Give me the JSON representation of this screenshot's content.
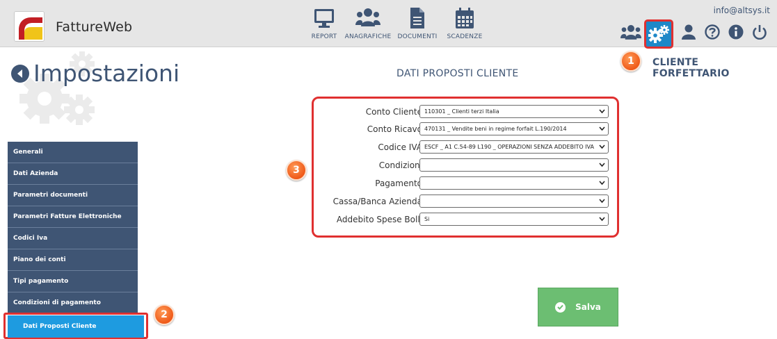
{
  "app": {
    "brand": "FattureWeb",
    "user_email": "info@altsys.it"
  },
  "nav": [
    {
      "label": "REPORT",
      "icon": "monitor-icon"
    },
    {
      "label": "ANAGRAFICHE",
      "icon": "users-icon"
    },
    {
      "label": "DOCUMENTI",
      "icon": "document-icon"
    },
    {
      "label": "SCADENZE",
      "icon": "calendar-icon"
    }
  ],
  "toolbar_icons": [
    "users-icon",
    "gears-icon",
    "user-icon",
    "help-icon",
    "info-icon",
    "power-icon"
  ],
  "context_label": "CLIENTE FORFETTARIO",
  "page": {
    "title": "Impostazioni",
    "section_title": "DATI PROPOSTI CLIENTE"
  },
  "sidebar": {
    "items": [
      {
        "label": "Generali"
      },
      {
        "label": "Dati Azienda"
      },
      {
        "label": "Parametri documenti"
      },
      {
        "label": "Parametri Fatture Elettroniche"
      },
      {
        "label": "Codici Iva"
      },
      {
        "label": "Piano dei conti"
      },
      {
        "label": "Tipi pagamento"
      },
      {
        "label": "Condizioni di pagamento"
      }
    ],
    "active": {
      "label": "Dati Proposti Cliente"
    }
  },
  "form": {
    "fields": [
      {
        "label": "Conto Cliente",
        "value": "110301 _ Clienti terzi Italia"
      },
      {
        "label": "Conto Ricavo",
        "value": "470131 _ Vendite beni in regime forfait L.190/2014"
      },
      {
        "label": "Codice IVA",
        "value": "ESCF _ A1 C.54-89 L190 _ OPERAZIONI SENZA ADDEBITO IVA"
      },
      {
        "label": "Condizioni",
        "value": ""
      },
      {
        "label": "Pagamento",
        "value": ""
      },
      {
        "label": "Cassa/Banca Azienda",
        "value": ""
      },
      {
        "label": "Addebito Spese Bolli",
        "value": "Si"
      }
    ],
    "save_label": "Salva"
  },
  "callouts": {
    "one": "1",
    "two": "2",
    "three": "3"
  },
  "colors": {
    "nav_blue": "#3f5574",
    "active_blue": "#1e9be0",
    "highlight_red": "#e03030",
    "save_green": "#6cbe72",
    "badge_orange": "#ef5a19"
  }
}
